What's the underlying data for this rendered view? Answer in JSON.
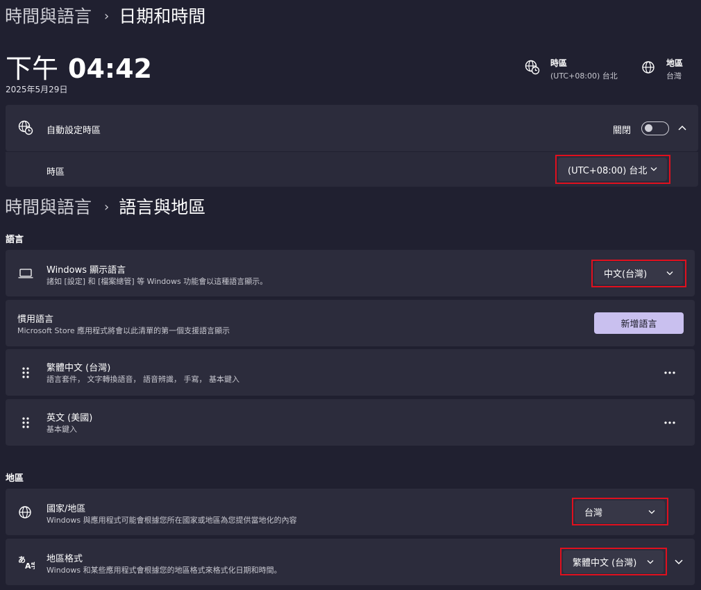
{
  "datetime": {
    "breadcrumb_parent": "時間與語言",
    "breadcrumb_current": "日期和時間",
    "time_prefix": "下午",
    "time": "04:42",
    "date": "2025年5月29日",
    "timezone_label": "時區",
    "timezone_value": "(UTC+08:00) 台北",
    "region_label": "地區",
    "region_value": "台灣",
    "auto_tz": {
      "label": "自動設定時區",
      "toggle_text": "關閉"
    },
    "tz_row": {
      "label": "時區",
      "selected": "(UTC+08:00) 台北"
    }
  },
  "lang": {
    "breadcrumb_parent": "時間與語言",
    "breadcrumb_current": "語言與地區",
    "section_language": "語言",
    "display_lang": {
      "title": "Windows 顯示語言",
      "desc": "諸如 [設定] 和 [檔案總管] 等 Windows 功能會以這種語言顯示。",
      "selected": "中文(台灣)"
    },
    "preferred": {
      "title": "慣用語言",
      "desc": "Microsoft Store 應用程式將會以此清單的第一個支援語言顯示",
      "add_button": "新增語言"
    },
    "languages": [
      {
        "name": "繁體中文 (台灣)",
        "features": "語言套件， 文字轉換語音， 語音辨識， 手寫， 基本鍵入"
      },
      {
        "name": "英文 (美國)",
        "features": "基本鍵入"
      }
    ],
    "section_region": "地區",
    "country": {
      "title": "國家/地區",
      "desc": "Windows 與應用程式可能會根據您所在國家或地區為您提供當地化的內容",
      "selected": "台灣"
    },
    "format": {
      "title": "地區格式",
      "desc": "Windows 和某些應用程式會根據您的地區格式來格式化日期和時間。",
      "selected": "繁體中文 (台灣)"
    }
  },
  "colors": {
    "background": "#202030",
    "card": "#2c2c3c",
    "highlight": "#e0101e",
    "accent_button": "#c9c0ef"
  }
}
